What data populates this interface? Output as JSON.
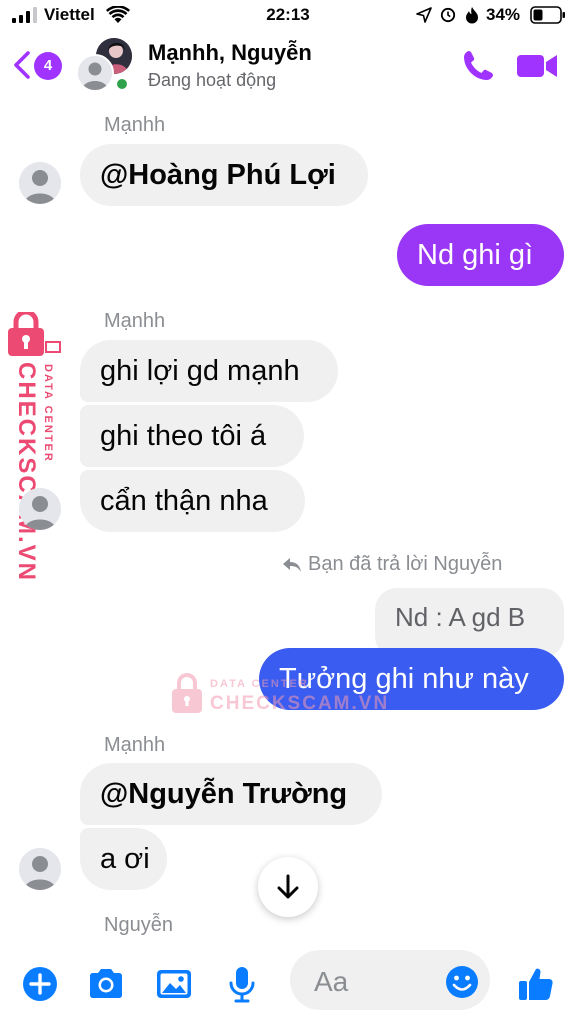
{
  "status_bar": {
    "carrier": "Viettel",
    "time": "22:13",
    "battery": "34%"
  },
  "header": {
    "back_badge": "4",
    "title": "Mạnhh, Nguyễn",
    "status": "Đang hoạt động",
    "online": true
  },
  "messages": {
    "group1": {
      "sender": "Mạnhh",
      "text": "@Hoàng Phú Lợi"
    },
    "sent1": {
      "text": "Nd ghi gì"
    },
    "group2": {
      "sender": "Mạnhh",
      "lines": [
        "ghi lợi gd mạnh",
        "ghi theo tôi á",
        "cẩn thận nha"
      ]
    },
    "reply": {
      "note": "Bạn đã trả lời Nguyễn",
      "quoted": "Nd : A gd B",
      "text": "Tưởng ghi như này"
    },
    "group3": {
      "sender": "Mạnhh",
      "lines": [
        "@Nguyễn Trường",
        "a ơi"
      ]
    },
    "next_sender": "Nguyễn"
  },
  "watermark": {
    "line1": "DATA CENTER",
    "line2": "CHECKSCAM.VN"
  },
  "composer": {
    "placeholder": "Aa"
  },
  "colors": {
    "accent": "#a033ff",
    "sent_gradient_top": "#9a36f5",
    "sent_gradient_bottom": "#3b5cf0",
    "incoming_bubble": "#f0f0f0",
    "online": "#31a24c",
    "composer_icons": "#0a7cff",
    "watermark": "#ec4a72"
  }
}
